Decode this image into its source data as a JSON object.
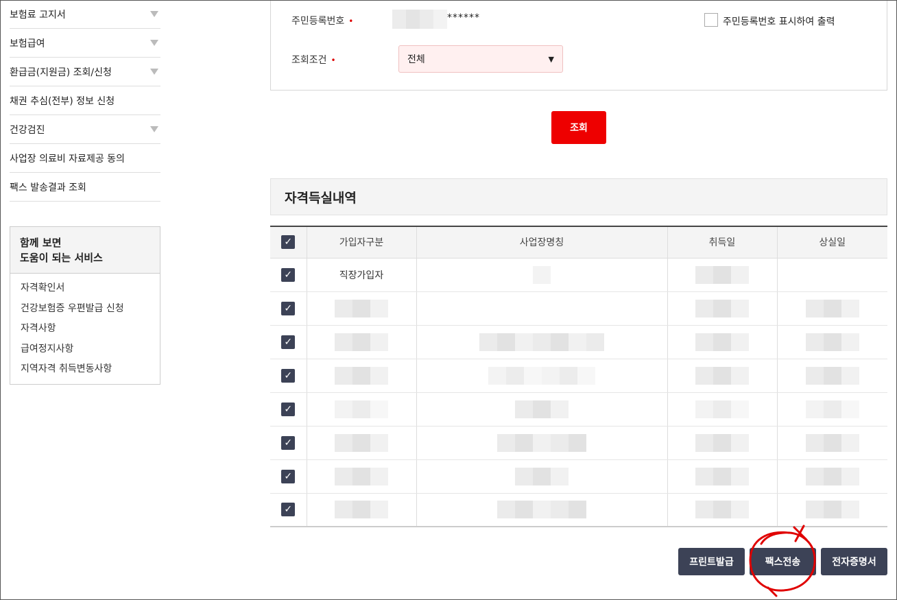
{
  "sidebar": {
    "items": [
      {
        "label": "보험료 고지서",
        "expandable": true
      },
      {
        "label": "보험급여",
        "expandable": true
      },
      {
        "label": "환급금(지원금) 조회/신청",
        "expandable": true
      },
      {
        "label": "채권 추심(전부) 정보 신청",
        "expandable": false
      },
      {
        "label": "건강검진",
        "expandable": true
      },
      {
        "label": "사업장 의료비 자료제공 동의",
        "expandable": false
      },
      {
        "label": "팩스 발송결과 조회",
        "expandable": false
      }
    ],
    "related": {
      "title_line1": "함께 보면",
      "title_line2": "도움이 되는 서비스",
      "links": [
        "자격확인서",
        "건강보험증 우편발급 신청",
        "자격사항",
        "급여정지사항",
        "지역자격 취득변동사항"
      ]
    }
  },
  "form": {
    "resident_label": "주민등록번호",
    "resident_masked": "******",
    "show_resident_label": "주민등록번호 표시하여 출력",
    "condition_label": "조회조건",
    "condition_value": "전체",
    "required_mark": "•"
  },
  "search_label": "조회",
  "section_title": "자격득실내역",
  "table": {
    "headers": [
      "가입자구분",
      "사업장명칭",
      "취득일",
      "상실일"
    ],
    "first_row_type": "직장가입자",
    "row_count": 8
  },
  "actions": {
    "print": "프린트발급",
    "fax": "팩스전송",
    "electronic": "전자증명서"
  },
  "colors": {
    "primary_red": "#ee0000",
    "dark_button": "#3c4256",
    "annotation_red": "#e00000"
  }
}
